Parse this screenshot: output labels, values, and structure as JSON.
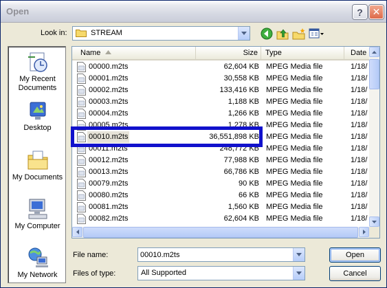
{
  "window": {
    "title": "Open",
    "help_symbol": "?",
    "close_symbol": "✕"
  },
  "lookin": {
    "label": "Look in:",
    "value": "STREAM",
    "folder_icon": "folder-icon"
  },
  "toolbar": {
    "icons": [
      "back-icon",
      "up-folder-icon",
      "new-folder-icon",
      "views-menu-icon"
    ]
  },
  "places": [
    {
      "label_1": "My Recent",
      "label_2": "Documents",
      "icon": "recent-documents-icon"
    },
    {
      "label_1": "Desktop",
      "label_2": "",
      "icon": "desktop-icon"
    },
    {
      "label_1": "My Documents",
      "label_2": "",
      "icon": "my-documents-icon"
    },
    {
      "label_1": "My Computer",
      "label_2": "",
      "icon": "my-computer-icon"
    },
    {
      "label_1": "My Network",
      "label_2": "",
      "icon": "my-network-icon"
    }
  ],
  "list": {
    "columns": {
      "name": "Name",
      "size": "Size",
      "type": "Type",
      "date": "Date"
    },
    "rows": [
      {
        "name": "00000.m2ts",
        "size": "62,604 KB",
        "type": "MPEG Media file",
        "date": "1/18/"
      },
      {
        "name": "00001.m2ts",
        "size": "30,558 KB",
        "type": "MPEG Media file",
        "date": "1/18/"
      },
      {
        "name": "00002.m2ts",
        "size": "133,416 KB",
        "type": "MPEG Media file",
        "date": "1/18/"
      },
      {
        "name": "00003.m2ts",
        "size": "1,188 KB",
        "type": "MPEG Media file",
        "date": "1/18/"
      },
      {
        "name": "00004.m2ts",
        "size": "1,266 KB",
        "type": "MPEG Media file",
        "date": "1/18/"
      },
      {
        "name": "00005.m2ts",
        "size": "1,278 KB",
        "type": "MPEG Media file",
        "date": "1/18/"
      },
      {
        "name": "00010.m2ts",
        "size": "36,551,898 KB",
        "type": "MPEG Media file",
        "date": "1/18/",
        "selected": true
      },
      {
        "name": "00011.m2ts",
        "size": "248,772 KB",
        "type": "MPEG Media file",
        "date": "1/18/"
      },
      {
        "name": "00012.m2ts",
        "size": "77,988 KB",
        "type": "MPEG Media file",
        "date": "1/18/"
      },
      {
        "name": "00013.m2ts",
        "size": "66,786 KB",
        "type": "MPEG Media file",
        "date": "1/18/"
      },
      {
        "name": "00079.m2ts",
        "size": "90 KB",
        "type": "MPEG Media file",
        "date": "1/18/"
      },
      {
        "name": "00080.m2ts",
        "size": "66 KB",
        "type": "MPEG Media file",
        "date": "1/18/"
      },
      {
        "name": "00081.m2ts",
        "size": "1,560 KB",
        "type": "MPEG Media file",
        "date": "1/18/"
      },
      {
        "name": "00082.m2ts",
        "size": "62,604 KB",
        "type": "MPEG Media file",
        "date": "1/18/"
      }
    ]
  },
  "filename": {
    "label": "File name:",
    "value": "00010.m2ts"
  },
  "filetype": {
    "label": "Files of type:",
    "value": "All Supported"
  },
  "buttons": {
    "open": "Open",
    "cancel": "Cancel"
  },
  "colors": {
    "highlight_border": "#1111cc",
    "selection_bg": "#e6e3d8",
    "dialog_bg": "#ece9d8"
  }
}
